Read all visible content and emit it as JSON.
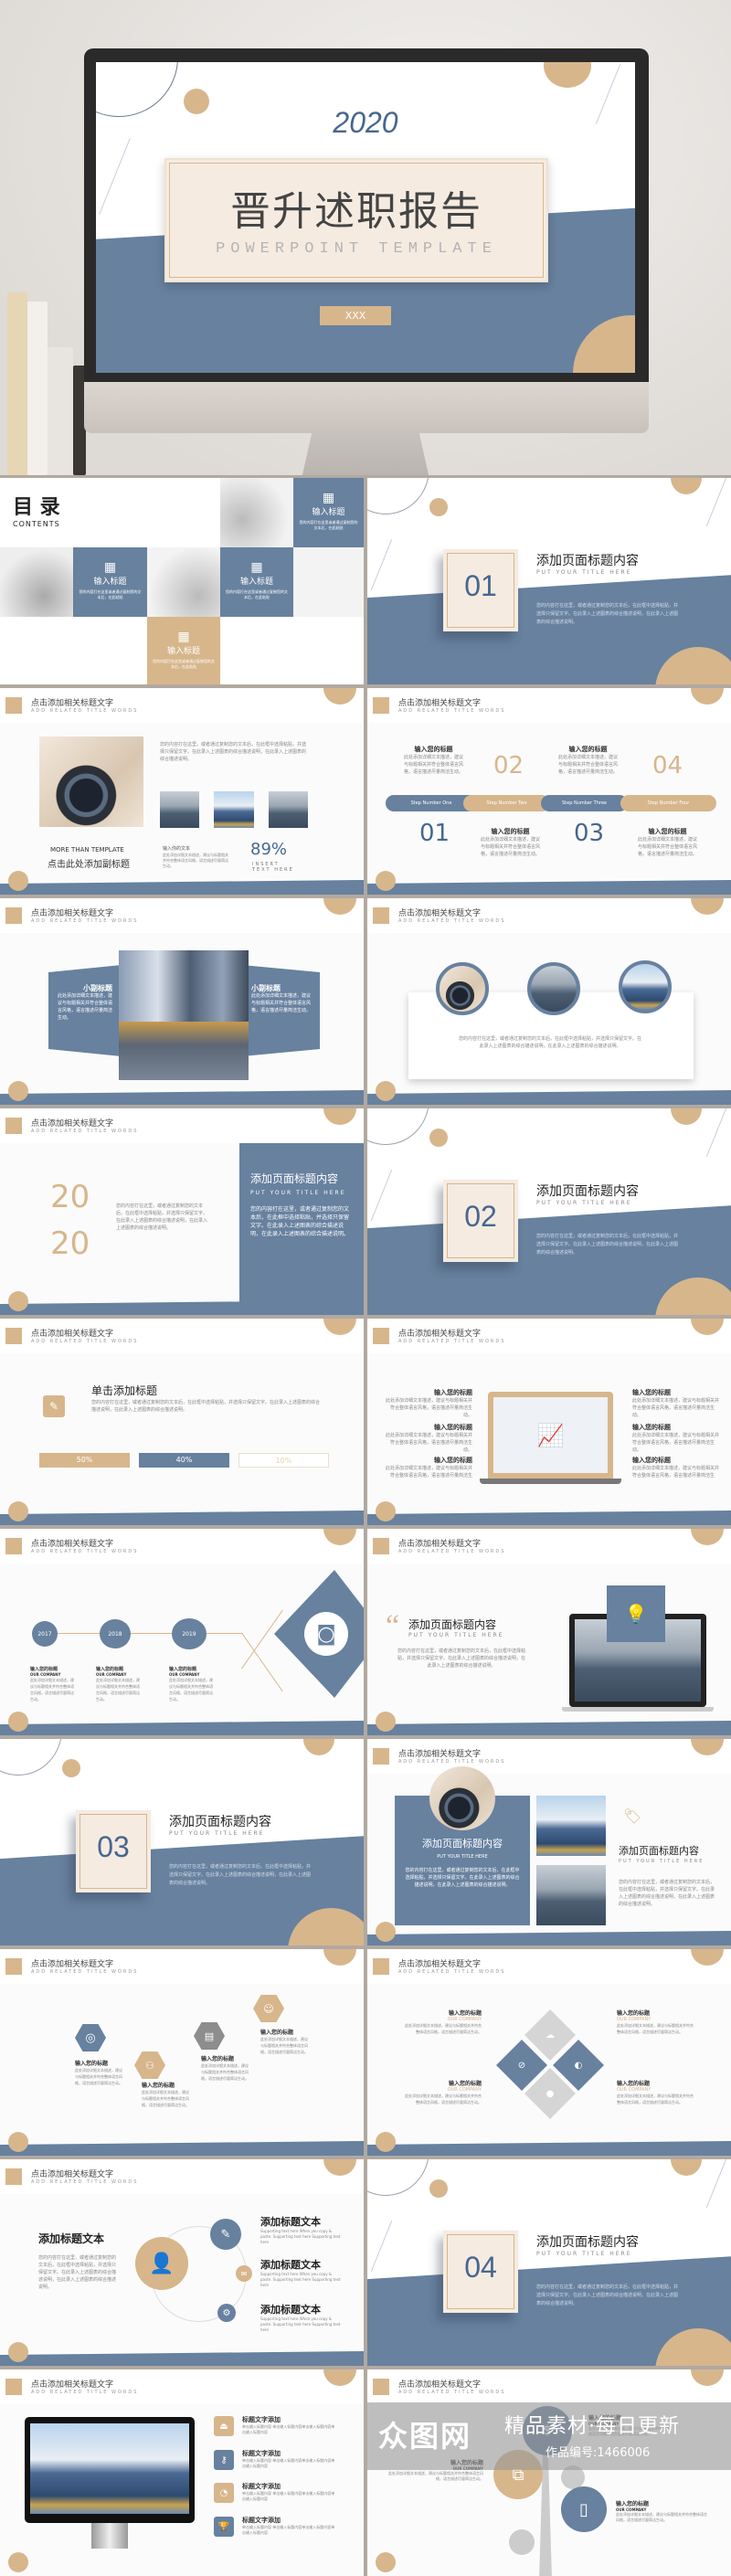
{
  "colors": {
    "blue": "#67819f",
    "tan": "#d7b68c",
    "beige": "#f5ebe1"
  },
  "hero": {
    "year": "2020",
    "title": "晋升述职报告",
    "subtitle": "POWERPOINT TEMPLATE",
    "button": "XXX"
  },
  "common": {
    "header_title": "点击添加相关标题文字",
    "header_sub": "ADD RELATED TITLE WORDS",
    "body": "您的内容打在这里，或者通过复制您的文本后，在此框中选择粘贴，并选择只保留文字。在此录入上述图表的综合描述说明，在此录入上述图表的综合描述说明。",
    "short": "此处添加详细文本描述，建议与标题相关并符合整体语言风格，语言描述尽量简洁生动。",
    "item_title": "输入您的标题",
    "company": "OUR COMPANY"
  },
  "contents": {
    "title": "目 录",
    "subtitle": "CONTENTS",
    "item_label": "输入标题",
    "item_desc": "您的内容打在这里或者通过复制您的文本后，在此粘贴",
    "icon": "building-icon"
  },
  "sections": [
    {
      "num": "01"
    },
    {
      "num": "02"
    },
    {
      "num": "03"
    },
    {
      "num": "04"
    }
  ],
  "section": {
    "title": "添加页面标题内容",
    "subtitle": "PUT YOUR TITLE HERE"
  },
  "slide_photos": {
    "more": "MORE THAN TEMPLATE",
    "subtitle": "点击此处添加副标题",
    "small_title": "输入你的文本",
    "percent": "89%",
    "insert": "INSERT TEXT HERE"
  },
  "steps": {
    "labels": [
      "Step Number One",
      "Step Number Two",
      "Step Number Three",
      "Step Number Four"
    ],
    "nums": [
      "01",
      "02",
      "03",
      "04"
    ]
  },
  "sub_titles": {
    "label": "小副标题"
  },
  "year_slide": {
    "a": "20",
    "b": "20"
  },
  "bars": {
    "title": "单击添加标题",
    "values": [
      "50%",
      "40%",
      "10%"
    ]
  },
  "timeline": {
    "years": [
      "2017",
      "2018",
      "2019"
    ]
  },
  "tree_title": "添加标题文本",
  "support": "Supporting text here When you copy & paste. Supporting text here Supporting text here",
  "list": {
    "label": "标题文字添加",
    "desc": "单击输入标题内容 单击输入标题内容单击输入标题内容单击输入标题内容"
  },
  "watermark": {
    "brand": "众图网",
    "slogan": "精品素材·每日更新",
    "code": "作品编号:1466006"
  }
}
